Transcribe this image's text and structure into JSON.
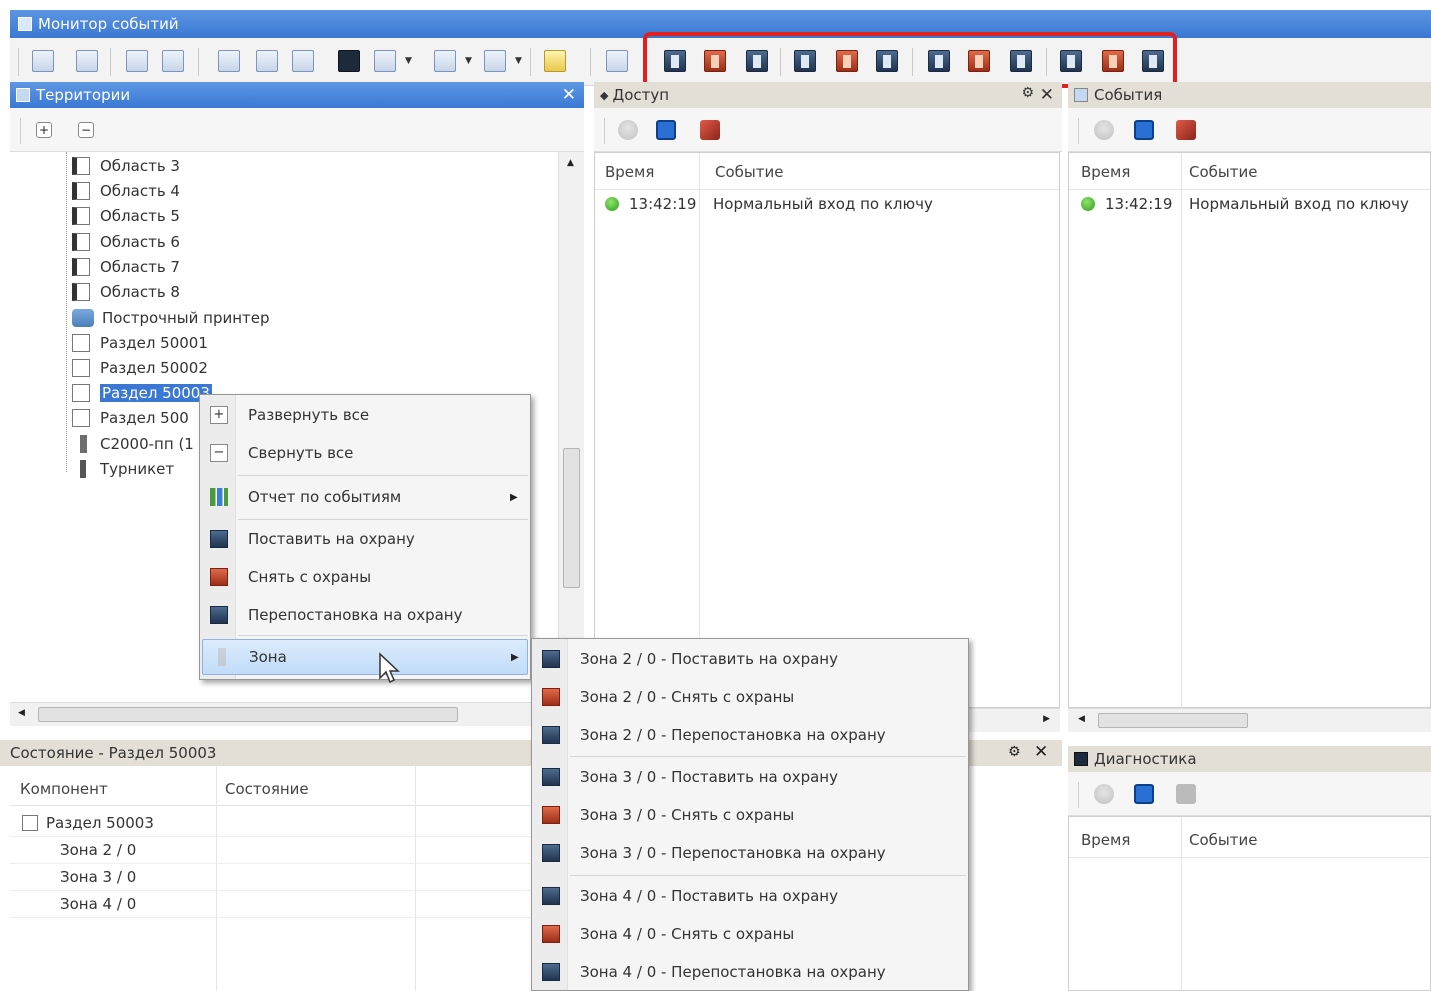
{
  "window": {
    "title": "Монитор событий"
  },
  "territory_panel": {
    "title": "Территории",
    "tree": [
      {
        "label": "Область 3",
        "icon": "area-icon"
      },
      {
        "label": "Область 4",
        "icon": "area-icon"
      },
      {
        "label": "Область 5",
        "icon": "area-icon"
      },
      {
        "label": "Область 6",
        "icon": "area-icon"
      },
      {
        "label": "Область 7",
        "icon": "area-icon"
      },
      {
        "label": "Область 8",
        "icon": "area-icon"
      },
      {
        "label": "Построчный принтер",
        "icon": "printer-icon"
      },
      {
        "label": "Раздел 50001",
        "icon": "partition-icon"
      },
      {
        "label": "Раздел 50002",
        "icon": "partition-icon"
      },
      {
        "label": "Раздел 50003",
        "icon": "partition-icon",
        "selected": true
      },
      {
        "label": "Раздел 500",
        "icon": "partition-icon"
      },
      {
        "label": "С2000-пп (1",
        "icon": "device-icon"
      },
      {
        "label": "Турникет",
        "icon": "turnstile-icon"
      }
    ]
  },
  "access_panel": {
    "title": "Доступ",
    "columns": {
      "time": "Время",
      "event": "Событие"
    },
    "rows": [
      {
        "time": "13:42:19",
        "event": "Нормальный вход по ключу"
      }
    ]
  },
  "events_panel": {
    "title": "События",
    "columns": {
      "time": "Время",
      "event": "Событие"
    },
    "rows": [
      {
        "time": "13:42:19",
        "event": "Нормальный вход по ключу"
      }
    ]
  },
  "state_panel": {
    "title": "Состояние - Раздел 50003",
    "columns": {
      "component": "Компонент",
      "state": "Состояние"
    },
    "rows": [
      {
        "component": "Раздел 50003",
        "state": ""
      },
      {
        "component": "Зона 2 / 0",
        "state": ""
      },
      {
        "component": "Зона 3 / 0",
        "state": ""
      },
      {
        "component": "Зона 4 / 0",
        "state": ""
      }
    ]
  },
  "diagnostics_panel": {
    "title": "Диагностика",
    "columns": {
      "time": "Время",
      "event": "Событие"
    }
  },
  "context_menu": {
    "items": [
      {
        "label": "Развернуть все",
        "icon": "expand-icon"
      },
      {
        "label": "Свернуть все",
        "icon": "collapse-icon"
      },
      {
        "label": "Отчет по событиям",
        "icon": "report-icon",
        "submenu": true
      },
      {
        "label": "Поставить на охрану",
        "icon": "arm-icon"
      },
      {
        "label": "Снять с охраны",
        "icon": "disarm-icon"
      },
      {
        "label": "Перепостановка на охрану",
        "icon": "rearm-icon"
      },
      {
        "label": "Зона",
        "icon": "zone-icon",
        "submenu": true,
        "hovered": true
      }
    ]
  },
  "zone_submenu": {
    "items": [
      {
        "label": "Зона 2 / 0 - Поставить на охрану",
        "icon": "arm-icon"
      },
      {
        "label": "Зона 2 / 0 - Снять с охраны",
        "icon": "disarm-icon"
      },
      {
        "label": "Зона 2 / 0 - Перепостановка на охрану",
        "icon": "rearm-icon"
      },
      {
        "label": "Зона 3 / 0 - Поставить на охрану",
        "icon": "arm-icon"
      },
      {
        "label": "Зона 3 / 0 - Снять с охраны",
        "icon": "disarm-icon"
      },
      {
        "label": "Зона 3 / 0 - Перепостановка на охрану",
        "icon": "rearm-icon"
      },
      {
        "label": "Зона 4 / 0 - Поставить на охрану",
        "icon": "arm-icon"
      },
      {
        "label": "Зона 4 / 0 - Снять с охраны",
        "icon": "disarm-icon"
      },
      {
        "label": "Зона 4 / 0 - Перепостановка на охрану",
        "icon": "rearm-icon"
      }
    ]
  },
  "colors": {
    "title_blue": "#3a78d4",
    "highlight_red": "#e21f1f",
    "arm_blue": "#20344f",
    "disarm_red": "#9c2e18"
  }
}
